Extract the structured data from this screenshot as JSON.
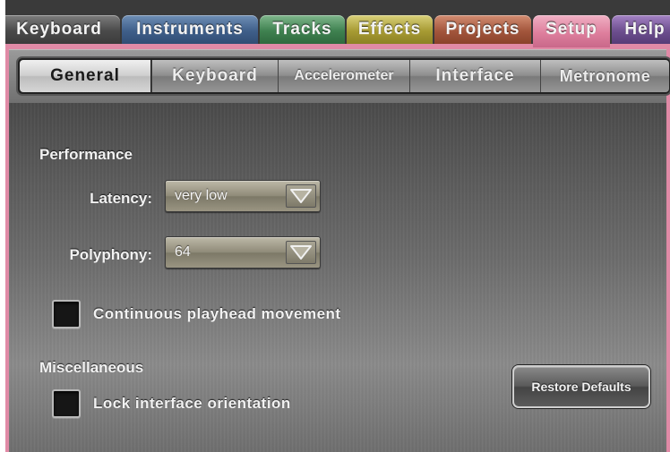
{
  "top_tabs": [
    {
      "label": "Keyboard"
    },
    {
      "label": "Instruments"
    },
    {
      "label": "Tracks"
    },
    {
      "label": "Effects"
    },
    {
      "label": "Projects"
    },
    {
      "label": "Setup"
    },
    {
      "label": "Help"
    }
  ],
  "active_top_tab": "Setup",
  "sub_tabs": [
    {
      "label": "General"
    },
    {
      "label": "Keyboard"
    },
    {
      "label": "Accelerometer"
    },
    {
      "label": "Interface"
    },
    {
      "label": "Metronome"
    }
  ],
  "active_sub_tab": "General",
  "performance": {
    "title": "Performance",
    "latency": {
      "label": "Latency:",
      "value": "very low"
    },
    "polyphony": {
      "label": "Polyphony:",
      "value": "64"
    },
    "continuous_playhead": {
      "label": "Continuous playhead movement",
      "checked": false
    }
  },
  "miscellaneous": {
    "title": "Miscellaneous",
    "lock_orientation": {
      "label": "Lock interface orientation",
      "checked": false
    }
  },
  "restore_button": {
    "label": "Restore Defaults"
  },
  "colors": {
    "setup_tab": "#de7f9d",
    "panel_border": "#e08aa6"
  },
  "icons": {
    "dropdown": "chevron-down-icon"
  }
}
